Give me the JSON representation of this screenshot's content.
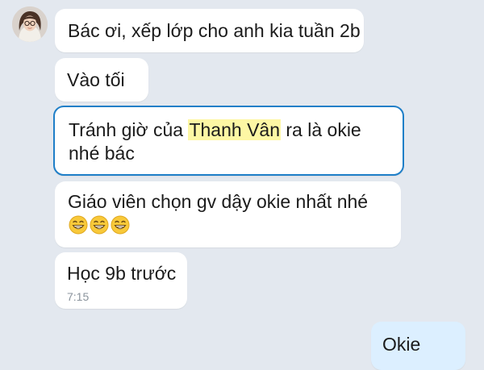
{
  "messages": [
    {
      "text": "Bác ơi, xếp lớp cho anh kia tuần 2b"
    },
    {
      "text": "Vào tối"
    },
    {
      "before": "Tránh giờ của ",
      "highlight": "Thanh Vân",
      "after": " ra là okie nhé bác"
    },
    {
      "text": "Giáo viên chọn gv dậy okie nhất nhé",
      "emoji": "grinning-face-emoji"
    },
    {
      "text": "Học 9b trước",
      "time": "7:15"
    },
    {
      "text": "Okie"
    }
  ],
  "colors": {
    "background": "#e3e8ef",
    "incoming_bubble": "#ffffff",
    "outgoing_bubble": "#dcefff",
    "selected_border": "#1f7fc8",
    "highlight": "#fdf7a4"
  }
}
